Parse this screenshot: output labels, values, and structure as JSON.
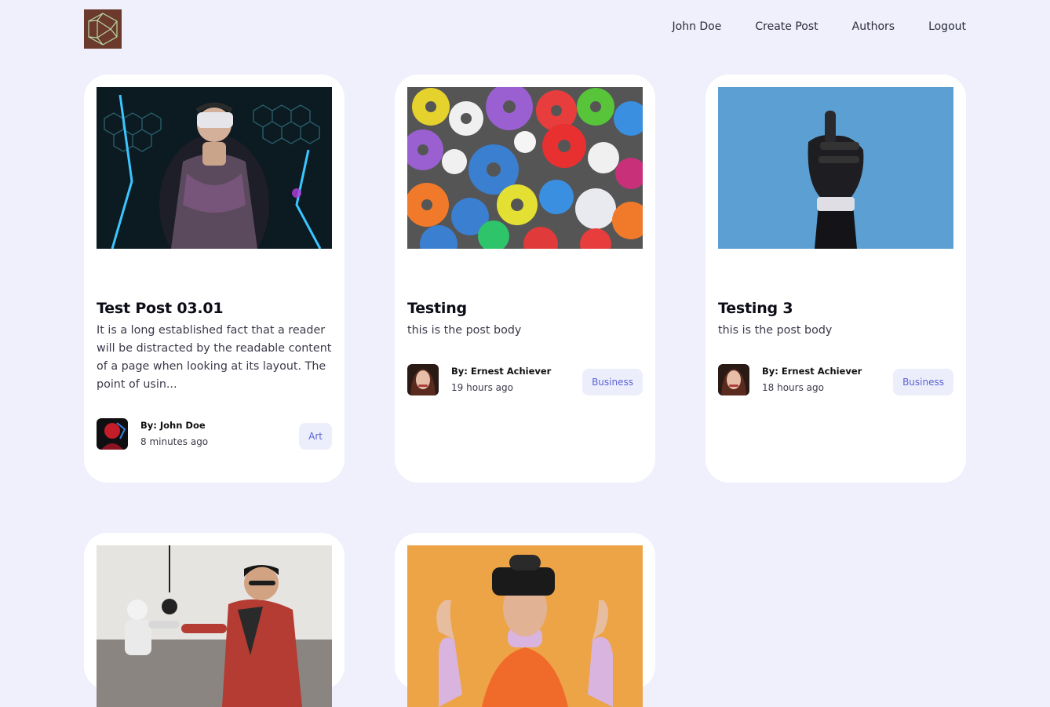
{
  "nav": {
    "logo_icon": "polyhedron-logo-icon",
    "user_label": "John Doe",
    "create_label": "Create Post",
    "authors_label": "Authors",
    "logout_label": "Logout"
  },
  "posts": [
    {
      "title": "Test Post 03.01",
      "body": "It is a long established fact that a reader will be distracted by the readable content of a page when looking at its layout. The point of usin...",
      "author": "By: John Doe",
      "time": "8 minutes ago",
      "category": "Art"
    },
    {
      "title": "Testing",
      "body": "this is the post body",
      "author": "By: Ernest Achiever",
      "time": "19 hours ago",
      "category": "Business"
    },
    {
      "title": "Testing 3",
      "body": "this is the post body",
      "author": "By: Ernest Achiever",
      "time": "18 hours ago",
      "category": "Business"
    },
    {},
    {}
  ],
  "colors": {
    "page_bg": "#eff0fc",
    "card_bg": "#ffffff",
    "badge_bg": "#eceefb",
    "badge_text": "#5b63d8"
  }
}
